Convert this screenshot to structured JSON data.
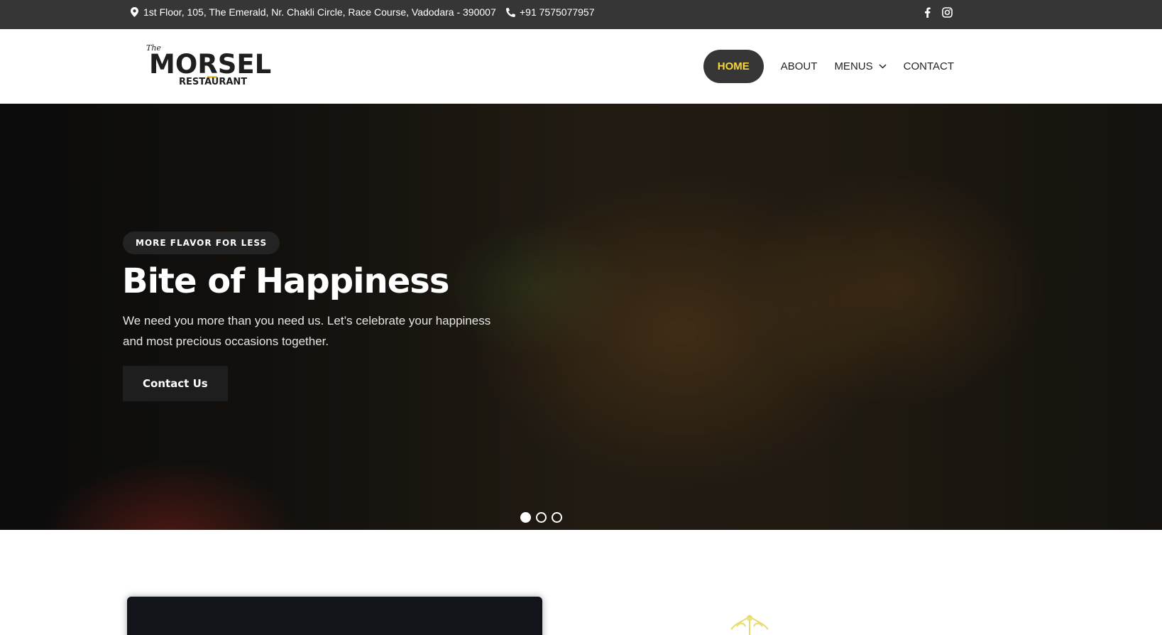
{
  "topbar": {
    "address": "1st Floor, 105, The Emerald, Nr. Chakli Circle, Race Course, Vadodara - 390007",
    "phone": "+91 7575077957",
    "social_icons": [
      "facebook-icon",
      "instagram-icon"
    ]
  },
  "logo": {
    "the": "The",
    "brand": "MORSEL",
    "sub": "RESTAURANT"
  },
  "nav": {
    "items": [
      {
        "label": "HOME",
        "active": true
      },
      {
        "label": "ABOUT"
      },
      {
        "label": "MENUS"
      },
      {
        "label": "CONTACT"
      }
    ]
  },
  "hero": {
    "badge": "MORE FLAVOR FOR LESS",
    "title": "Bite of Happiness",
    "text": "We need you more than you need us. Let’s celebrate your happiness and most precious occasions together.",
    "cta": "Contact Us",
    "slides": 3,
    "active_slide": 1
  },
  "colors": {
    "topbar_bg": "#363636",
    "accent": "#f5d63d",
    "dark": "#1e1e1e"
  }
}
